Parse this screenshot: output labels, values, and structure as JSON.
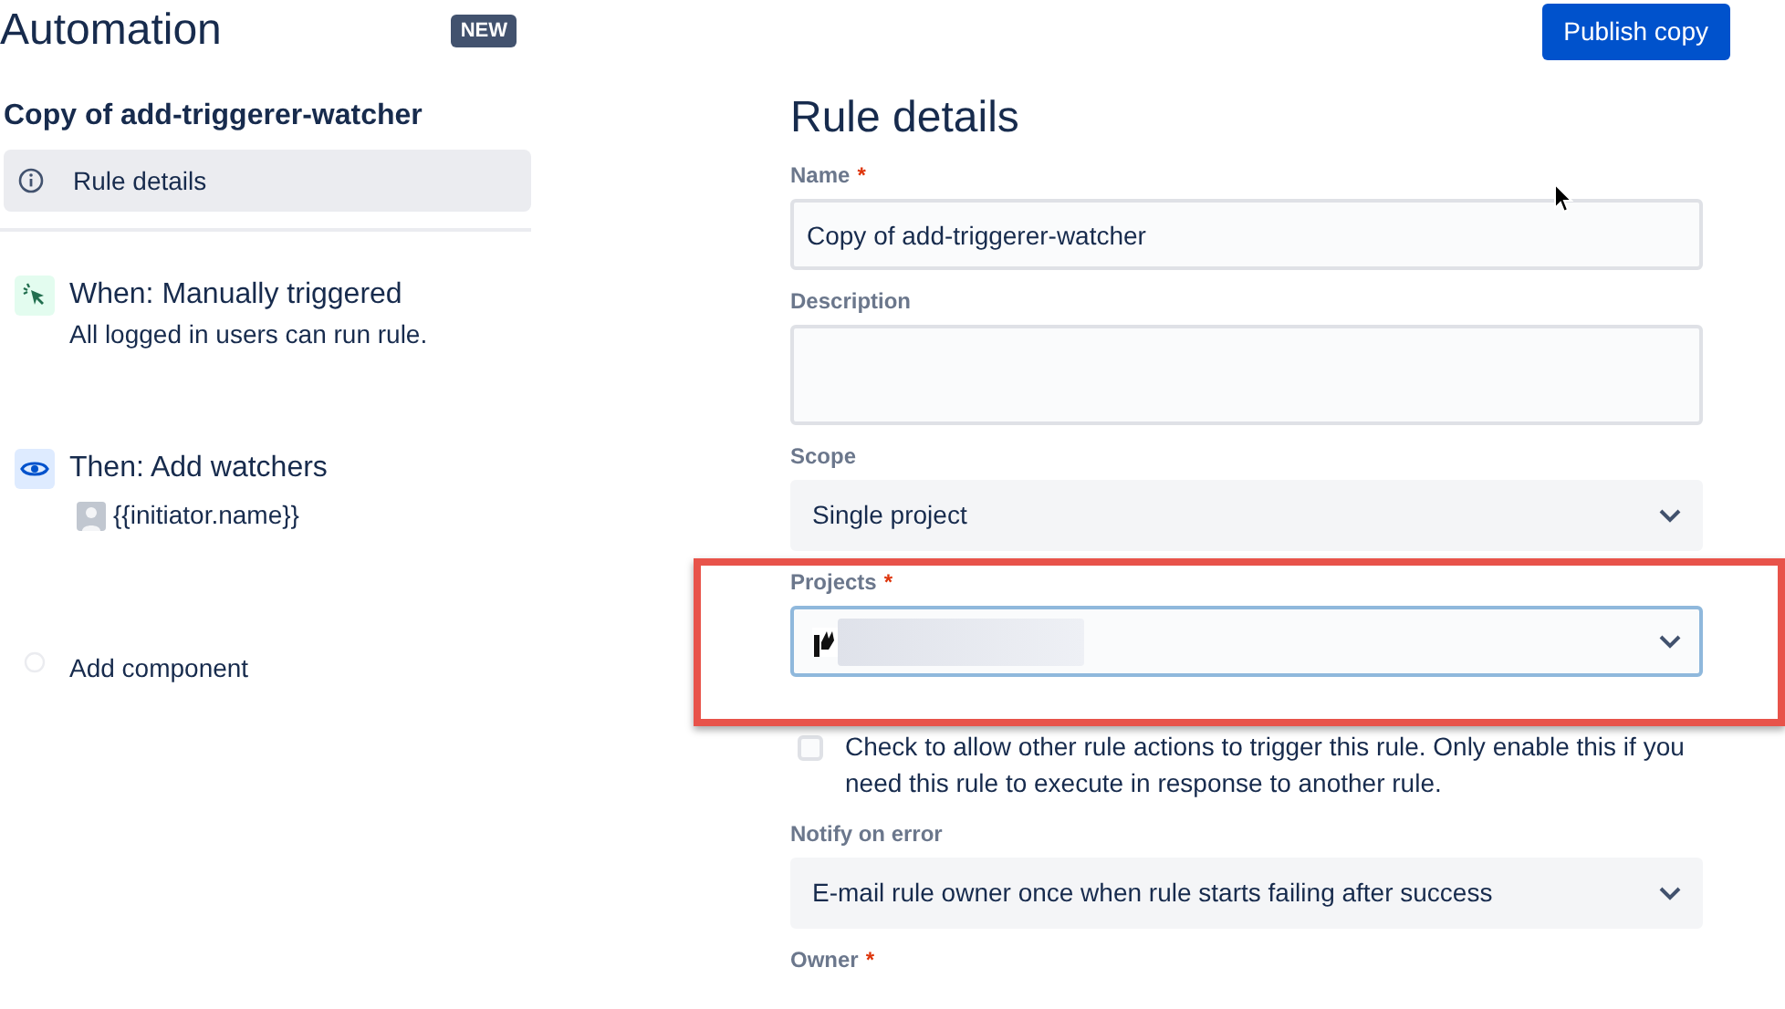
{
  "app": {
    "title": "Automation",
    "badge": "NEW"
  },
  "publish_button": "Publish copy",
  "rule_name": "Copy of add-triggerer-watcher",
  "sidebar": {
    "items": [
      {
        "kind": "details",
        "label": "Rule details",
        "selected": true
      },
      {
        "kind": "trigger",
        "title": "When: Manually triggered",
        "subtitle": "All logged in users can run rule.",
        "selected": false
      },
      {
        "kind": "action",
        "title": "Then: Add watchers",
        "value": "{{initiator.name}}",
        "selected": false
      },
      {
        "kind": "add",
        "label": "Add component",
        "selected": false
      }
    ]
  },
  "form": {
    "title": "Rule details",
    "fields": [
      {
        "kind": "text",
        "label": "Name",
        "required_mark": "*",
        "value": "Copy of add-triggerer-watcher"
      },
      {
        "kind": "textarea",
        "label": "Description"
      },
      {
        "kind": "select",
        "label": "Scope",
        "value": "Single project"
      },
      {
        "kind": "project",
        "label": "Projects",
        "required_mark": "*",
        "focused": true,
        "highlighted": true
      },
      {
        "kind": "checkbox",
        "text": "Check to allow other rule actions to trigger this rule. Only enable this if you need this rule to execute in response to another rule.",
        "checked": false
      },
      {
        "kind": "select",
        "label": "Notify on error",
        "value": "E-mail rule owner once when rule starts failing after success"
      },
      {
        "kind": "label",
        "label": "Owner",
        "required_mark": "*"
      }
    ]
  }
}
